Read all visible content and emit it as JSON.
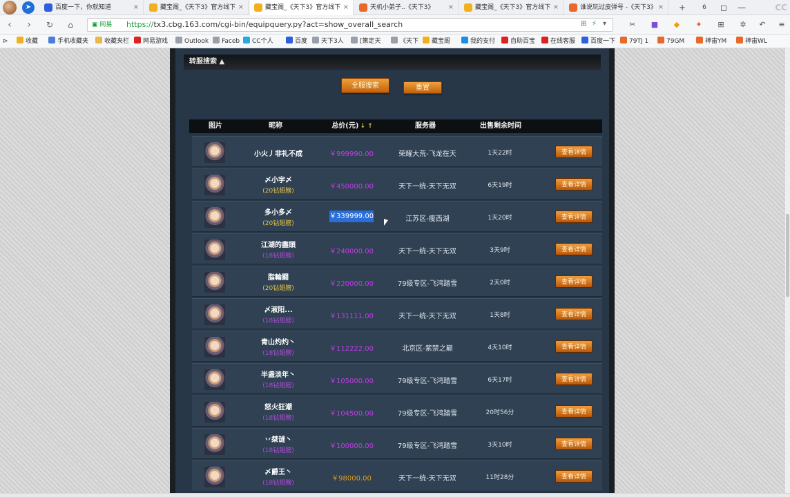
{
  "colors": {
    "price_purple": "#c23ee6",
    "price_orange": "#e39a1c",
    "sub_yellow": "#e8c24a",
    "sub_purple": "#b14bd8",
    "button_orange": "#e08626",
    "selection_blue": "#2a6ed9",
    "panel_bg": "#283748"
  },
  "browser": {
    "tabs": [
      {
        "label": "百度一下，你就知道",
        "icon": "baidu-paw-icon",
        "close": "×"
      },
      {
        "label": "藏宝阁_《天下3》官方线下",
        "icon": "cbg-treasure-icon",
        "close": "×"
      },
      {
        "label": "藏宝阁_《天下3》官方线下",
        "icon": "cbg-treasure-icon",
        "close": "×",
        "active": true
      },
      {
        "label": "天机小弟子..《天下3》",
        "icon": "tx3-game-icon",
        "close": "×"
      },
      {
        "label": "藏宝阁_《天下3》官方线下",
        "icon": "cbg-treasure-icon",
        "close": "×"
      },
      {
        "label": "谁说玩过皮弹号 -《天下3》",
        "icon": "tx3-game-icon",
        "close": "×"
      }
    ],
    "new_tab": "+",
    "tab_count": "6",
    "url_secure_label": "网易",
    "url_scheme": "https://",
    "url_host": "tx3.cbg.163.com",
    "url_path": "/cgi-bin/equipquery.py?act=show_overall_search",
    "bookmarks": [
      {
        "label": "收藏",
        "icon": "star-icon"
      },
      {
        "label": "手机收藏夹",
        "icon": "phone-icon"
      },
      {
        "label": "收藏夹栏",
        "icon": "folder-icon"
      },
      {
        "label": "网易游戏",
        "icon": "netease-icon"
      },
      {
        "label": "Outlook",
        "icon": "page-icon"
      },
      {
        "label": "Faceb",
        "icon": "page-icon"
      },
      {
        "label": "CC个人",
        "icon": "cc-icon"
      },
      {
        "label": "百度",
        "icon": "baidu-paw-icon"
      },
      {
        "label": "天下3人",
        "icon": "page-icon"
      },
      {
        "label": "[策定天",
        "icon": "page-icon"
      },
      {
        "label": "《天下",
        "icon": "page-icon"
      },
      {
        "label": "藏宝阁",
        "icon": "cbg-treasure-icon"
      },
      {
        "label": "我的支付",
        "icon": "alipay-icon"
      },
      {
        "label": "自助百宝",
        "icon": "netease-icon"
      },
      {
        "label": "在线客服",
        "icon": "netease-icon"
      },
      {
        "label": "百度一下",
        "icon": "baidu-paw-icon"
      },
      {
        "label": "79TJ 1",
        "icon": "tx3-game-icon"
      },
      {
        "label": "79GM",
        "icon": "tx3-game-icon"
      },
      {
        "label": "神宙YM",
        "icon": "tx3-game-icon"
      },
      {
        "label": "神宙WL",
        "icon": "tx3-game-icon"
      }
    ]
  },
  "page": {
    "section_title": "转服搜索 ▲",
    "search_all_button": "全服搜索",
    "reset_button": "重置",
    "columns": {
      "image": "图片",
      "nickname": "昵称",
      "total_price": "总价(元)",
      "sort_arrows": "↓ ↑",
      "server": "服务器",
      "remaining_time": "出售剩余时间"
    },
    "detail_label": "查看详情",
    "rows": [
      {
        "name": "小火丿非礼不成",
        "sub": "",
        "sub_tone": "none",
        "price": "￥999990.00",
        "price_tone": "purple",
        "server": "荣耀大荒-飞龙在天",
        "time": "1天22时"
      },
      {
        "name": "〆小宇〆",
        "sub": "(20钻翅膀)",
        "sub_tone": "yellow",
        "price": "￥450000.00",
        "price_tone": "purple",
        "server": "天下一统-天下无双",
        "time": "6天19时"
      },
      {
        "name": "多小多〆",
        "sub": "(20钻翅膀)",
        "sub_tone": "yellow",
        "price": "￥339999.00",
        "price_tone": "selected",
        "server": "江苏区-瘦西湖",
        "time": "1天20时"
      },
      {
        "name": "江湖的盡頭",
        "sub": "(18钻翅膀)",
        "sub_tone": "purple",
        "price": "￥240000.00",
        "price_tone": "purple",
        "server": "天下一统-天下无双",
        "time": "3天9时"
      },
      {
        "name": "脂輪闘",
        "sub": "(20钻翅膀)",
        "sub_tone": "yellow",
        "price": "￥220000.00",
        "price_tone": "purple",
        "server": "79级专区-飞鸿踏雪",
        "time": "2天0时"
      },
      {
        "name": "〆淑阳...",
        "sub": "(18钻翅膀)",
        "sub_tone": "purple",
        "price": "￥131111.00",
        "price_tone": "purple",
        "server": "天下一统-天下无双",
        "time": "1天8时"
      },
      {
        "name": "青山灼灼丶",
        "sub": "(18钻翅膀)",
        "sub_tone": "purple",
        "price": "￥112222.00",
        "price_tone": "purple",
        "server": "北京区-紫禁之巅",
        "time": "4天10时"
      },
      {
        "name": "半盏淡年丶",
        "sub": "(18钻翅膀)",
        "sub_tone": "purple",
        "price": "￥105000.00",
        "price_tone": "purple",
        "server": "79级专区-飞鸿踏雪",
        "time": "6天17时"
      },
      {
        "name": "怒火狂潮",
        "sub": "(18钻翅膀)",
        "sub_tone": "purple",
        "price": "￥104500.00",
        "price_tone": "purple",
        "server": "79级专区-飞鸿踏雪",
        "time": "20时56分"
      },
      {
        "name": "丷桀谜丶",
        "sub": "(18钻翅膀)",
        "sub_tone": "purple",
        "price": "￥100000.00",
        "price_tone": "purple",
        "server": "79级专区-飞鸿踏雪",
        "time": "3天10时"
      },
      {
        "name": "〆爵王丶",
        "sub": "(18钻翅膀)",
        "sub_tone": "purple",
        "price": "￥98000.00",
        "price_tone": "orange",
        "server": "天下一统-天下无双",
        "time": "11时28分"
      }
    ]
  }
}
